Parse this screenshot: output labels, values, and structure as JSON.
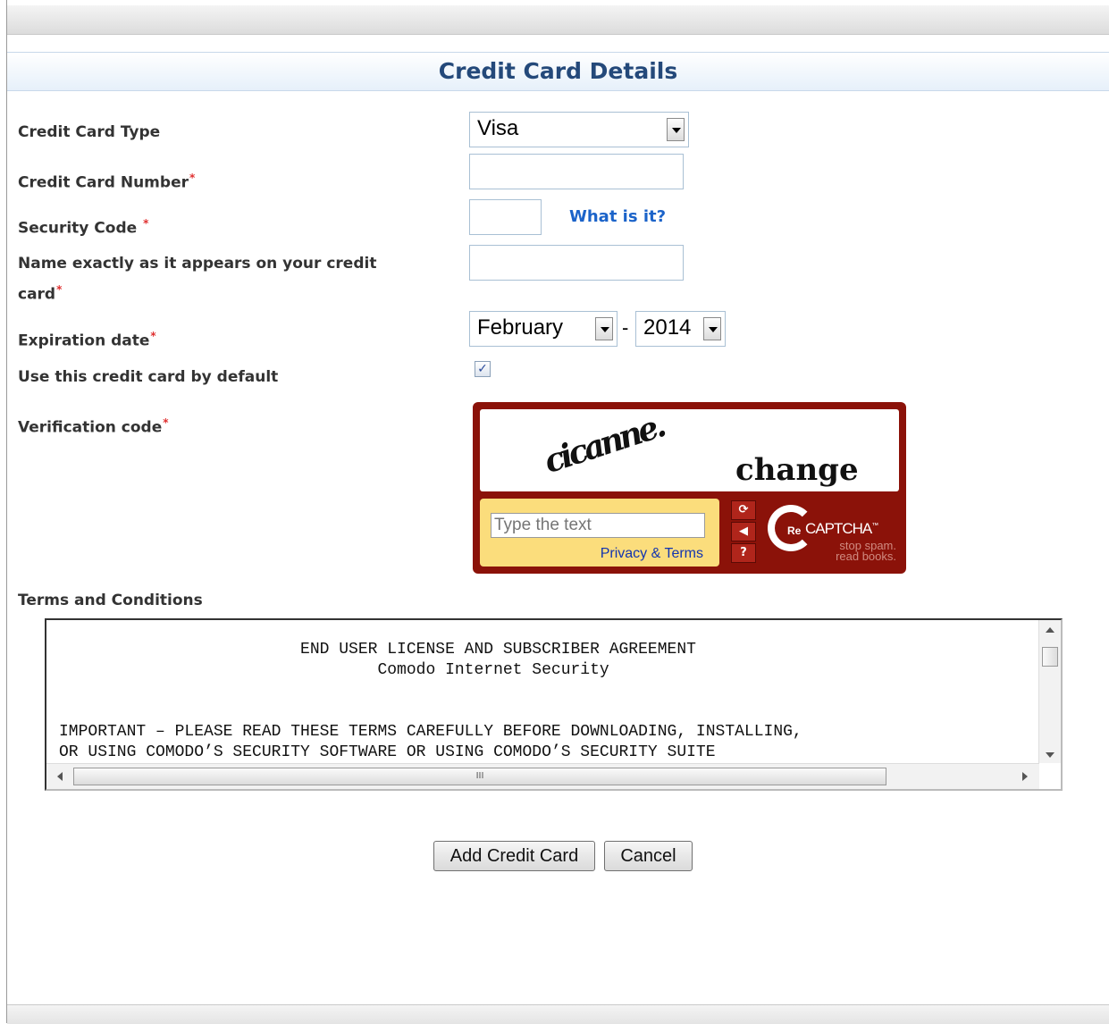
{
  "header": {
    "title": "Credit Card Details"
  },
  "labels": {
    "card_type": "Credit Card Type",
    "card_number": "Credit Card Number",
    "security_code": "Security Code",
    "name_line1": "Name exactly as it appears on your credit",
    "name_line2": "card",
    "expiration": "Expiration date",
    "default": "Use this credit card by default",
    "verification": "Verification code",
    "terms": "Terms and Conditions",
    "required_mark": "*"
  },
  "fields": {
    "card_type_value": "Visa",
    "card_number_value": "",
    "security_code_value": "",
    "name_value": "",
    "exp_month": "February",
    "exp_separator": "-",
    "exp_year": "2014",
    "default_checked": true,
    "check_glyph": "✓"
  },
  "links": {
    "what_is_it": "What is it?"
  },
  "captcha": {
    "word1": "cicanne.",
    "word2": "change",
    "placeholder": "Type the text",
    "privacy": "Privacy & Terms",
    "logo_re": "Re",
    "logo_name": "CAPTCHA",
    "logo_tm": "™",
    "tagline1": "stop spam.",
    "tagline2": "read books.",
    "btn_refresh": "⟳",
    "btn_audio": "◀",
    "btn_help": "?"
  },
  "terms_text": "                         END USER LICENSE AND SUBSCRIBER AGREEMENT\n                                 Comodo Internet Security\n\n\nIMPORTANT – PLEASE READ THESE TERMS CAREFULLY BEFORE DOWNLOADING, INSTALLING,\nOR USING COMODO’S SECURITY SOFTWARE OR USING COMODO’S SECURITY SUITE",
  "scrollbar": {
    "thumb_grip": "III"
  },
  "buttons": {
    "add": "Add Credit Card",
    "cancel": "Cancel"
  }
}
